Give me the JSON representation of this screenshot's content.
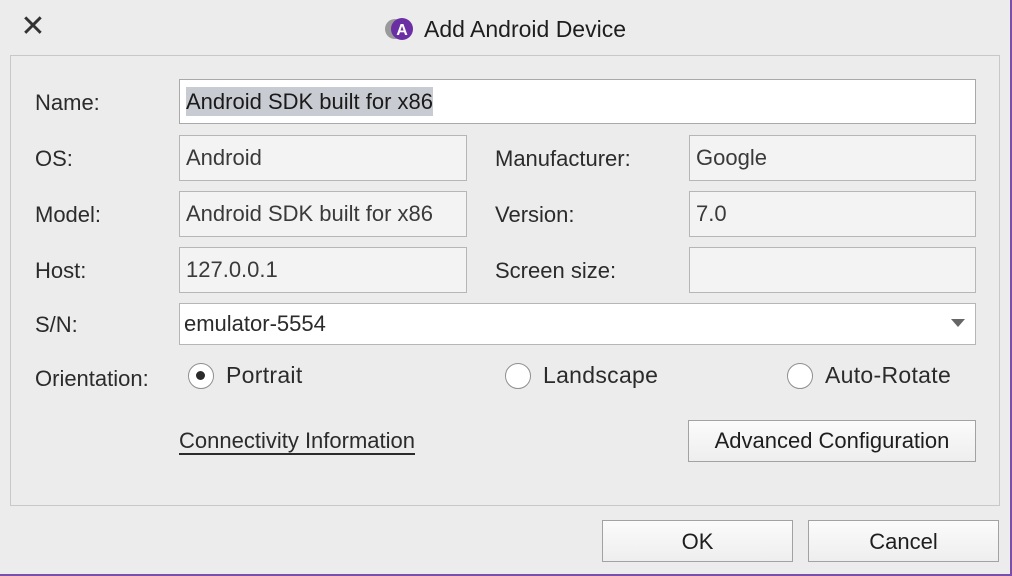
{
  "window": {
    "title": "Add Android Device",
    "close_symbol": "✕",
    "accent_color": "#7b4ea8"
  },
  "form": {
    "name": {
      "label": "Name:",
      "value": "Android SDK built for x86"
    },
    "os": {
      "label": "OS:",
      "value": "Android"
    },
    "manufacturer": {
      "label": "Manufacturer:",
      "value": "Google"
    },
    "model": {
      "label": "Model:",
      "value": "Android SDK built for x86"
    },
    "version": {
      "label": "Version:",
      "value": "7.0"
    },
    "host": {
      "label": "Host:",
      "value": "127.0.0.1"
    },
    "screen_size": {
      "label": "Screen size:",
      "value": ""
    },
    "sn": {
      "label": "S/N:",
      "value": "emulator-5554"
    },
    "orientation": {
      "label": "Orientation:",
      "options": [
        "Portrait",
        "Landscape",
        "Auto-Rotate"
      ],
      "selected": "Portrait"
    }
  },
  "links": {
    "connectivity": "Connectivity Information"
  },
  "buttons": {
    "advanced": "Advanced Configuration",
    "ok": "OK",
    "cancel": "Cancel"
  },
  "icons": {
    "title_icon": "android-app-icon",
    "close_icon": "close-icon"
  }
}
